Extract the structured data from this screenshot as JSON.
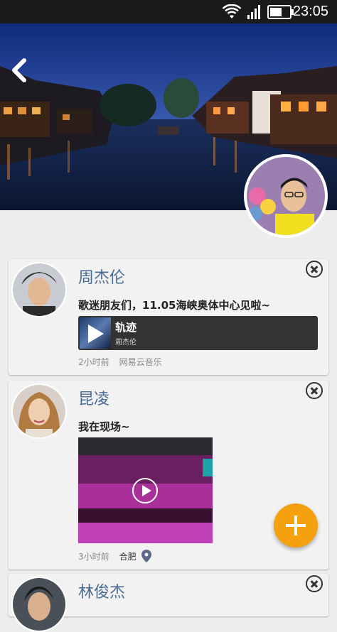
{
  "status_bar": {
    "time": "23:05"
  },
  "posts": [
    {
      "name": "周杰伦",
      "text": "歌迷朋友们，11.05海峡奥体中心见啦~",
      "music": {
        "title": "轨迹",
        "artist": "周杰伦"
      },
      "time": "2小时前",
      "source": "网易云音乐"
    },
    {
      "name": "昆凌",
      "text": "我在现场~",
      "time": "3小时前",
      "location": "合肥"
    },
    {
      "name": "林俊杰"
    }
  ],
  "colors": {
    "accent": "#f5a10f",
    "name": "#4a6b94"
  },
  "icons": [
    "back-icon",
    "close-icon",
    "play-icon",
    "location-icon",
    "add-icon",
    "wifi-icon",
    "signal-icon",
    "battery-icon"
  ]
}
